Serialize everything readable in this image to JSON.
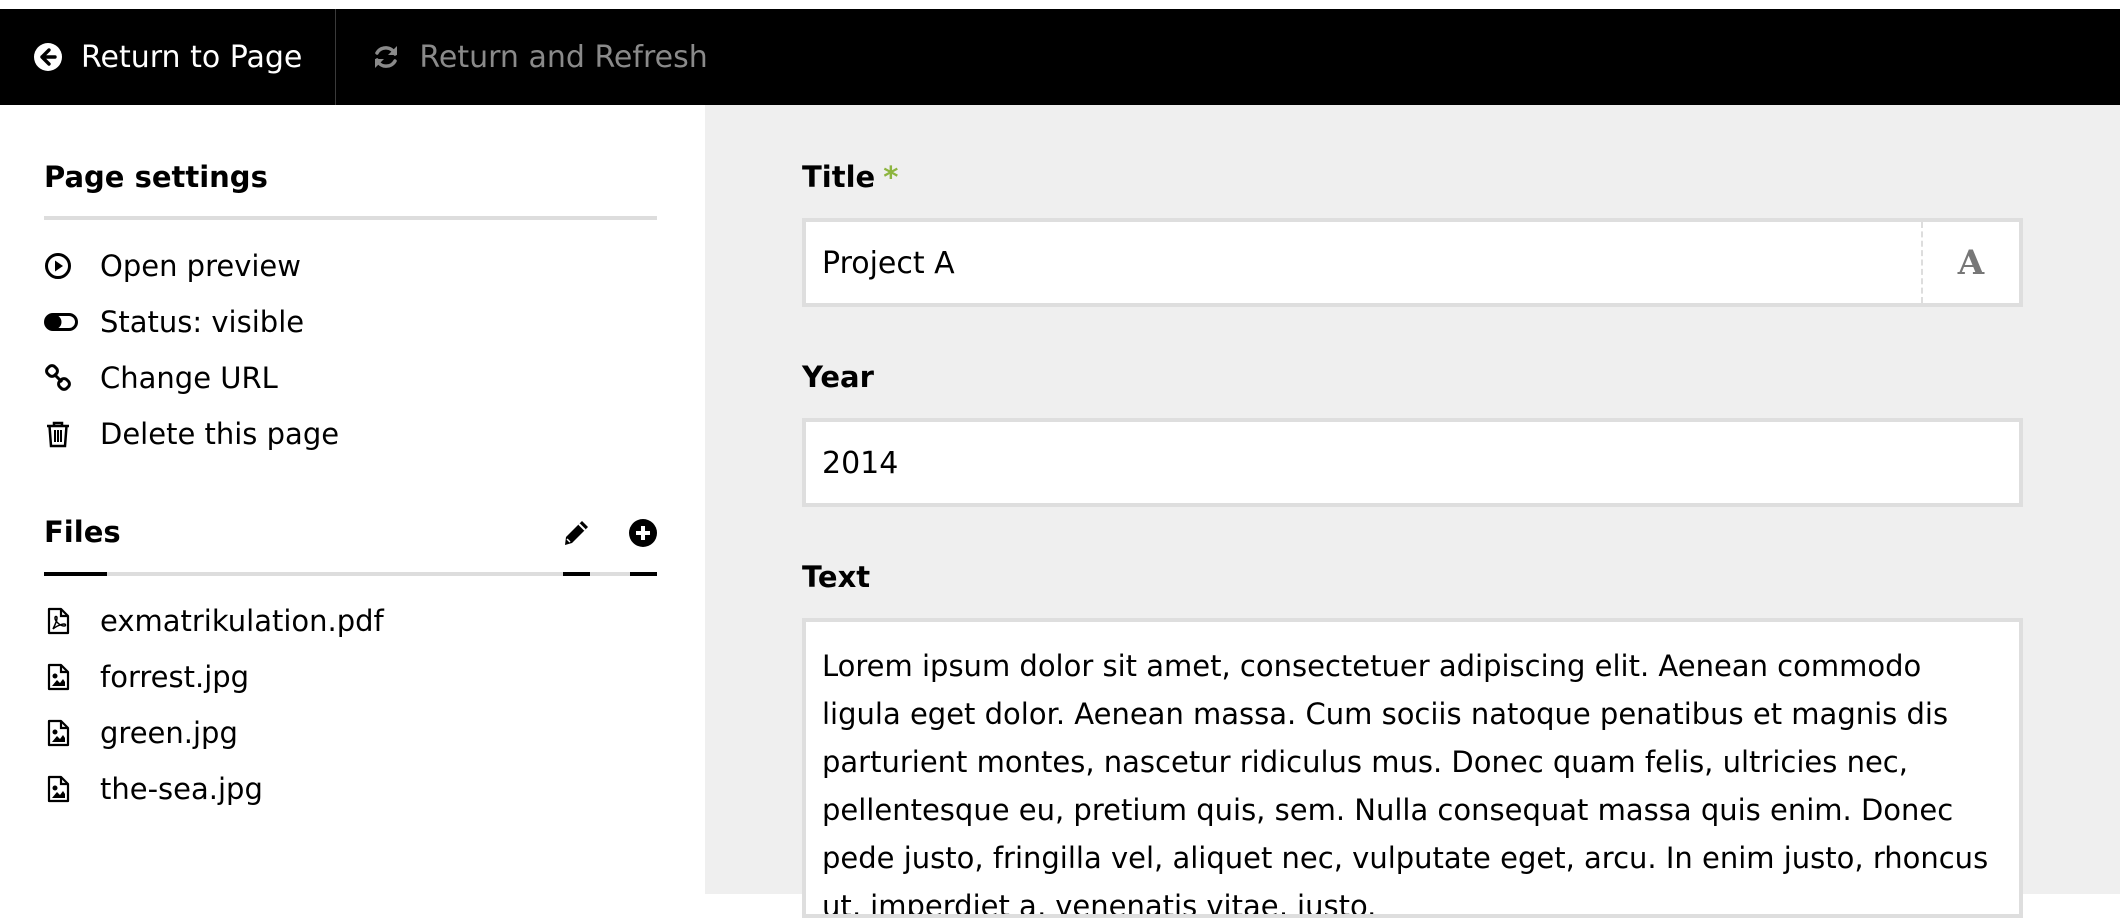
{
  "topbar": {
    "return_label": "Return to Page",
    "return_refresh_label": "Return and Refresh"
  },
  "sidebar": {
    "settings_title": "Page settings",
    "settings_items": [
      {
        "label": "Open preview",
        "icon": "play-circle-icon"
      },
      {
        "label": "Status: visible",
        "icon": "toggle-on-icon"
      },
      {
        "label": "Change URL",
        "icon": "link-icon"
      },
      {
        "label": "Delete this page",
        "icon": "trash-icon"
      }
    ],
    "files_title": "Files",
    "files": [
      {
        "name": "exmatrikulation.pdf",
        "icon": "pdf-file-icon"
      },
      {
        "name": "forrest.jpg",
        "icon": "image-file-icon"
      },
      {
        "name": "green.jpg",
        "icon": "image-file-icon"
      },
      {
        "name": "the-sea.jpg",
        "icon": "image-file-icon"
      }
    ]
  },
  "form": {
    "title_label": "Title",
    "title_required_mark": "*",
    "title_value": "Project A",
    "title_widget": "A",
    "year_label": "Year",
    "year_value": "2014",
    "text_label": "Text",
    "text_value": "Lorem ipsum dolor sit amet, consectetuer adipiscing elit. Aenean commodo ligula eget dolor. Aenean massa. Cum sociis natoque penatibus et magnis dis parturient montes, nascetur ridiculus mus. Donec quam felis, ultricies nec, pellentesque eu, pretium quis, sem. Nulla consequat massa quis enim. Donec pede justo, fringilla vel, aliquet nec, vulputate eget, arcu. In enim justo, rhoncus ut, imperdiet a, venenatis vitae, justo."
  },
  "colors": {
    "topbar_bg": "#000000",
    "main_bg": "#efefef",
    "required": "#8db53f",
    "muted": "#8a8a8a"
  }
}
